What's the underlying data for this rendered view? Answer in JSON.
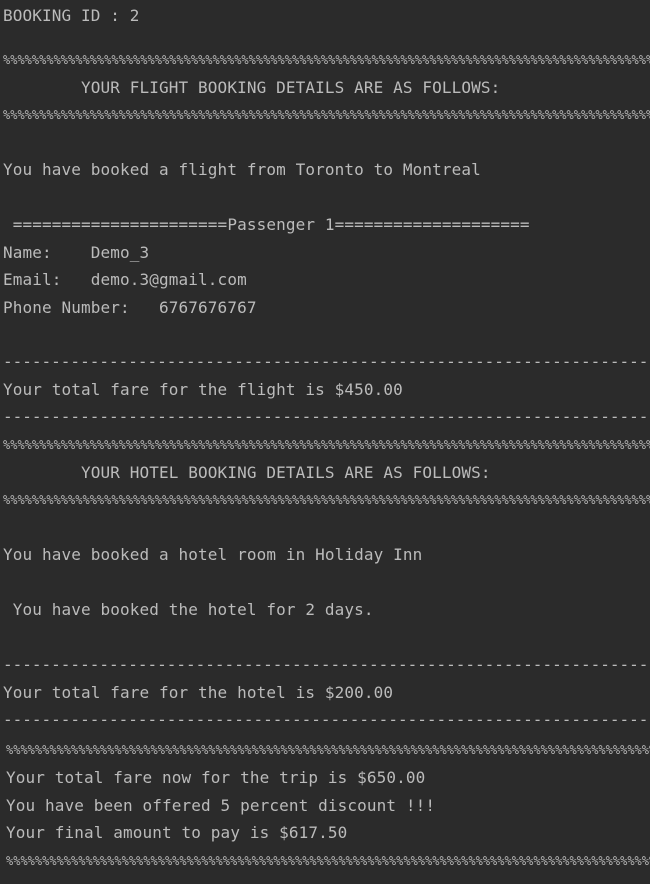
{
  "console": {
    "booking_id": "BOOKING ID : 2",
    "percent_rule": "%%%%%%%%%%%%%%%%%%%%%%%%%%%%%%%%%%%%%%%%%%%%%%%%%%%%%%%%%%%%%%%%%%%%%%%%%%%%%%%%%%%%%%%%%%%%%%%%%%%%%%%%%%%%%%%%%%%%%%%%%%%%%%%%%%%%%%%%%%%%%%%%%%%%%%%%%%%%%%%%%%%%%%%%%%%%%%%%",
    "dash_rule": "----------------------------------------------------------------------------------------------------",
    "flight_header": "        YOUR FLIGHT BOOKING DETAILS ARE AS FOLLOWS:",
    "flight_route": "You have booked a flight from Toronto to Montreal",
    "passenger_header": " ======================Passenger 1====================",
    "name_line": "Name:    Demo_3",
    "email_line": "Email:   demo.3@gmail.com",
    "phone_line": "Phone Number:   6767676767",
    "flight_fare": "Your total fare for the flight is $450.00",
    "hotel_header": "        YOUR HOTEL BOOKING DETAILS ARE AS FOLLOWS:",
    "hotel_booked": "You have booked a hotel room in Holiday Inn",
    "hotel_days": " You have booked the hotel for 2 days.",
    "hotel_fare": "Your total fare for the hotel is $200.00",
    "trip_total": "Your total fare now for the trip is $650.00",
    "discount": "You have been offered 5 percent discount !!!",
    "final_amount": "Your final amount to pay is $617.50"
  }
}
